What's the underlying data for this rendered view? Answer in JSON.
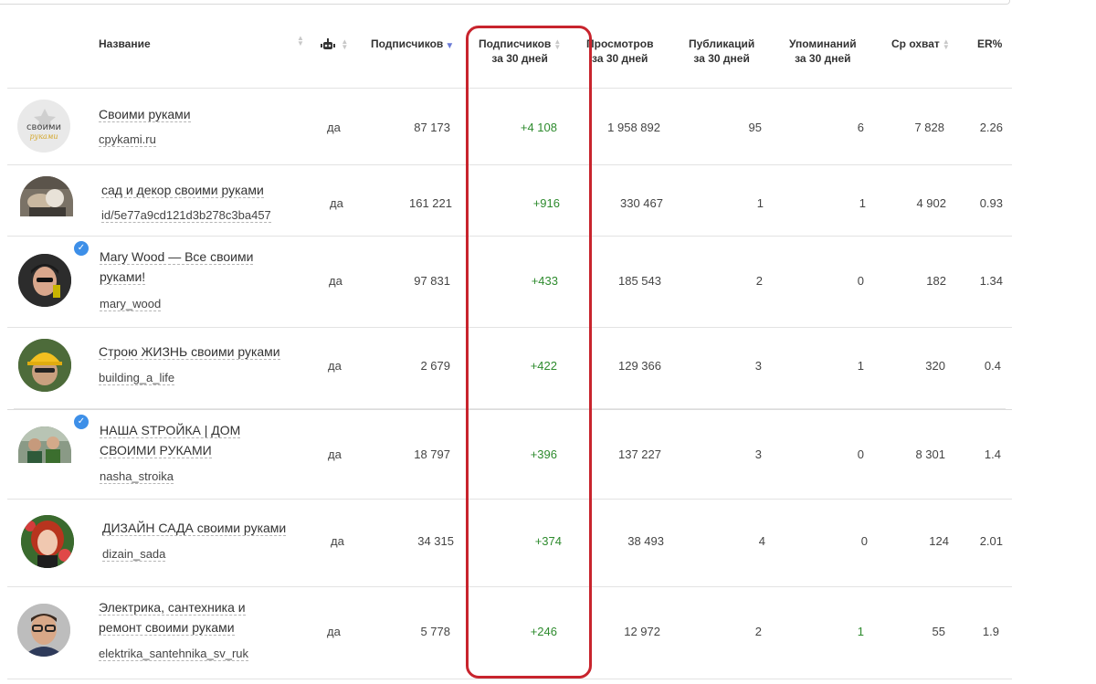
{
  "header": {
    "name": "Название",
    "subscribers": "Подписчиков",
    "subs30_l1": "Подписчиков",
    "subs30_l2": "за 30 дней",
    "views_l1": "Просмотров",
    "views_l2": "за 30 дней",
    "posts_l1": "Публикаций",
    "posts_l2": "за 30 дней",
    "mentions_l1": "Упоминаний",
    "mentions_l2": "за 30 дней",
    "reach": "Ср охват",
    "er": "ER%"
  },
  "colors": {
    "highlight": "#c8242d",
    "positive": "#2e8b2e",
    "sort_active": "#6b7bd6",
    "verified": "#3d8fe8"
  },
  "rows": [
    {
      "name": "Своими руками",
      "handle": "cpykami.ru",
      "avatar_icon": "logo-svoimi-rukami",
      "avatar_text_1": "своими",
      "avatar_text_2": "руками",
      "verified": false,
      "bot": "да",
      "subscribers": "87 173",
      "subs30": "+4 108",
      "views30": "1 958 892",
      "posts30": "95",
      "mentions30": "6",
      "reach": "7 828",
      "er": "2.26"
    },
    {
      "name": "сад и декор своими руками",
      "handle": "id/5e77a9cd121d3b278c3ba457",
      "avatar_icon": "photo-craft",
      "verified": false,
      "bot": "да",
      "subscribers": "161 221",
      "subs30": "+916",
      "views30": "330 467",
      "posts30": "1",
      "mentions30": "1",
      "reach": "4 902",
      "er": "0.93"
    },
    {
      "name_l1": "Mary Wood — Все своими",
      "name_l2": "руками!",
      "handle": "mary_wood",
      "avatar_icon": "photo-woman",
      "verified": true,
      "bot": "да",
      "subscribers": "97 831",
      "subs30": "+433",
      "views30": "185 543",
      "posts30": "2",
      "mentions30": "0",
      "reach": "182",
      "er": "1.34"
    },
    {
      "name": "Строю ЖИЗНЬ своими руками",
      "handle": "building_a_life",
      "avatar_icon": "photo-builder",
      "verified": false,
      "bot": "да",
      "subscribers": "2 679",
      "subs30": "+422",
      "views30": "129 366",
      "posts30": "3",
      "mentions30": "1",
      "reach": "320",
      "er": "0.4"
    },
    {
      "name_l1": "НАША STРОЙКА | ДОМ",
      "name_l2": "СВОИМИ РУКАМИ",
      "handle": "nasha_stroika",
      "avatar_icon": "photo-couple",
      "verified": true,
      "bot": "да",
      "subscribers": "18 797",
      "subs30": "+396",
      "views30": "137 227",
      "posts30": "3",
      "mentions30": "0",
      "reach": "8 301",
      "er": "1.4"
    },
    {
      "name": "ДИЗАЙН САДА своими руками",
      "handle": "dizain_sada",
      "avatar_icon": "photo-redhead",
      "verified": false,
      "bot": "да",
      "subscribers": "34 315",
      "subs30": "+374",
      "views30": "38 493",
      "posts30": "4",
      "mentions30": "0",
      "reach": "124",
      "er": "2.01"
    },
    {
      "name_l1": "Электрика, сантехника и",
      "name_l2": "ремонт своими руками",
      "handle": "elektrika_santehnika_sv_ruk",
      "avatar_icon": "photo-man-glasses",
      "verified": false,
      "bot": "да",
      "subscribers": "5 778",
      "subs30": "+246",
      "views30": "12 972",
      "posts30": "2",
      "mentions30": "1",
      "reach": "55",
      "er": "1.9"
    }
  ]
}
